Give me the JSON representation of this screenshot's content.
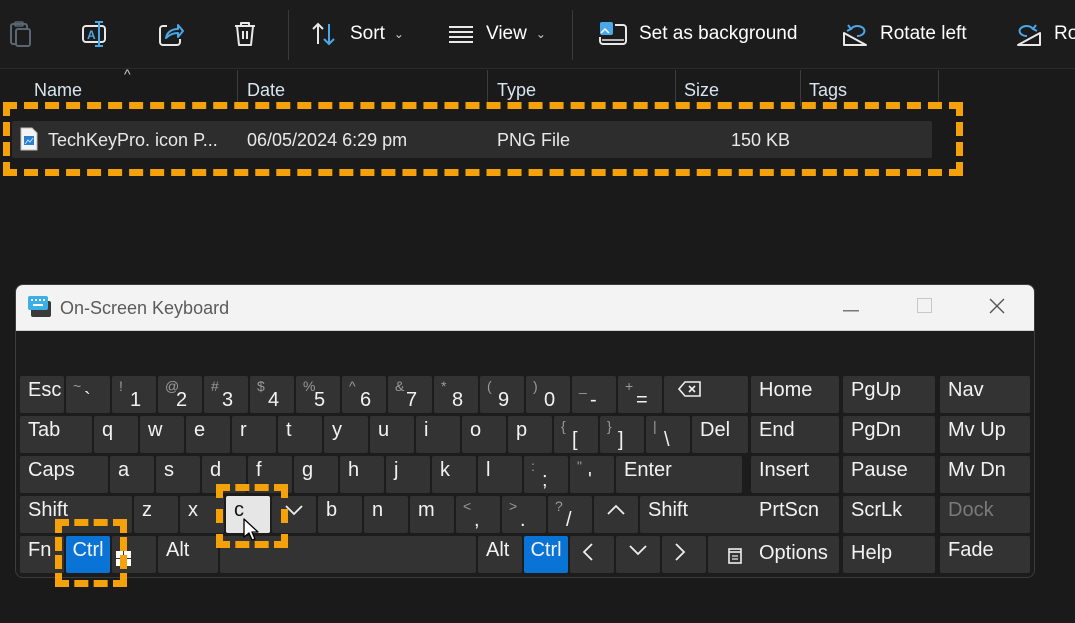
{
  "toolbar": {
    "items": [
      {
        "name": "clipboard-icon",
        "label": ""
      },
      {
        "name": "rename-icon",
        "label": ""
      },
      {
        "name": "share-icon",
        "label": ""
      },
      {
        "name": "delete-icon",
        "label": ""
      },
      {
        "name": "sort",
        "label": "Sort"
      },
      {
        "name": "view",
        "label": "View"
      },
      {
        "name": "set-as-background",
        "label": "Set as background"
      },
      {
        "name": "rotate-left",
        "label": "Rotate left"
      },
      {
        "name": "rotate-right",
        "label": "Ro"
      }
    ]
  },
  "file_list": {
    "columns": [
      "Name",
      "Date",
      "Type",
      "Size",
      "Tags"
    ],
    "rows": [
      {
        "name": "TechKeyPro. icon P...",
        "date": "06/05/2024 6:29 pm",
        "type": "PNG File",
        "size": "150 KB",
        "tags": ""
      }
    ]
  },
  "osk": {
    "title": "On-Screen Keyboard",
    "highlight_color": "#f5a20a",
    "active_key_color": "#0a74d6",
    "rows": {
      "row1": [
        {
          "main": "Esc"
        },
        {
          "shift": "~",
          "main": "`"
        },
        {
          "shift": "!",
          "main": "1"
        },
        {
          "shift": "@",
          "main": "2"
        },
        {
          "shift": "#",
          "main": "3"
        },
        {
          "shift": "$",
          "main": "4"
        },
        {
          "shift": "%",
          "main": "5"
        },
        {
          "shift": "^",
          "main": "6"
        },
        {
          "shift": "&",
          "main": "7"
        },
        {
          "shift": "*",
          "main": "8"
        },
        {
          "shift": "(",
          "main": "9"
        },
        {
          "shift": ")",
          "main": "0"
        },
        {
          "shift": "_",
          "main": "-"
        },
        {
          "shift": "+",
          "main": "="
        },
        {
          "main": "⌫",
          "icon": "backspace-icon"
        }
      ],
      "row2": [
        {
          "main": "Tab"
        },
        {
          "main": "q"
        },
        {
          "main": "w"
        },
        {
          "main": "e"
        },
        {
          "main": "r"
        },
        {
          "main": "t"
        },
        {
          "main": "y"
        },
        {
          "main": "u"
        },
        {
          "main": "i"
        },
        {
          "main": "o"
        },
        {
          "main": "p"
        },
        {
          "shift": "{",
          "main": "["
        },
        {
          "shift": "}",
          "main": "]"
        },
        {
          "shift": "|",
          "main": "\\"
        },
        {
          "main": "Del"
        }
      ],
      "row3": [
        {
          "main": "Caps"
        },
        {
          "main": "a"
        },
        {
          "main": "s"
        },
        {
          "main": "d"
        },
        {
          "main": "f"
        },
        {
          "main": "g"
        },
        {
          "main": "h"
        },
        {
          "main": "j"
        },
        {
          "main": "k"
        },
        {
          "main": "l"
        },
        {
          "shift": ":",
          "main": ";"
        },
        {
          "shift": "\"",
          "main": "'"
        },
        {
          "main": "Enter"
        }
      ],
      "row4": [
        {
          "main": "Shift"
        },
        {
          "main": "z"
        },
        {
          "main": "x"
        },
        {
          "main": "c"
        },
        {
          "main": "v"
        },
        {
          "main": "b"
        },
        {
          "main": "n"
        },
        {
          "main": "m"
        },
        {
          "shift": "<",
          "main": ","
        },
        {
          "shift": ">",
          "main": "."
        },
        {
          "shift": "?",
          "main": "/"
        },
        {
          "main": "^"
        },
        {
          "main": "Shift"
        }
      ],
      "row5": [
        {
          "main": "Fn"
        },
        {
          "main": "Ctrl"
        },
        {
          "main": "",
          "icon": "windows-icon"
        },
        {
          "main": "Alt"
        },
        {
          "main": ""
        },
        {
          "main": "Alt"
        },
        {
          "main": "Ctrl"
        },
        {
          "main": "<"
        },
        {
          "main": "v"
        },
        {
          "main": ">"
        },
        {
          "main": "",
          "icon": "menu-icon"
        }
      ]
    },
    "nav_keys": [
      [
        "Home",
        "PgUp",
        "Nav"
      ],
      [
        "End",
        "PgDn",
        "Mv Up"
      ],
      [
        "Insert",
        "Pause",
        "Mv Dn"
      ],
      [
        "PrtScn",
        "ScrLk",
        "Dock"
      ],
      [
        "Options",
        "Help",
        "Fade"
      ]
    ],
    "pressed_key": "c",
    "active_keys": [
      "Ctrl"
    ]
  }
}
